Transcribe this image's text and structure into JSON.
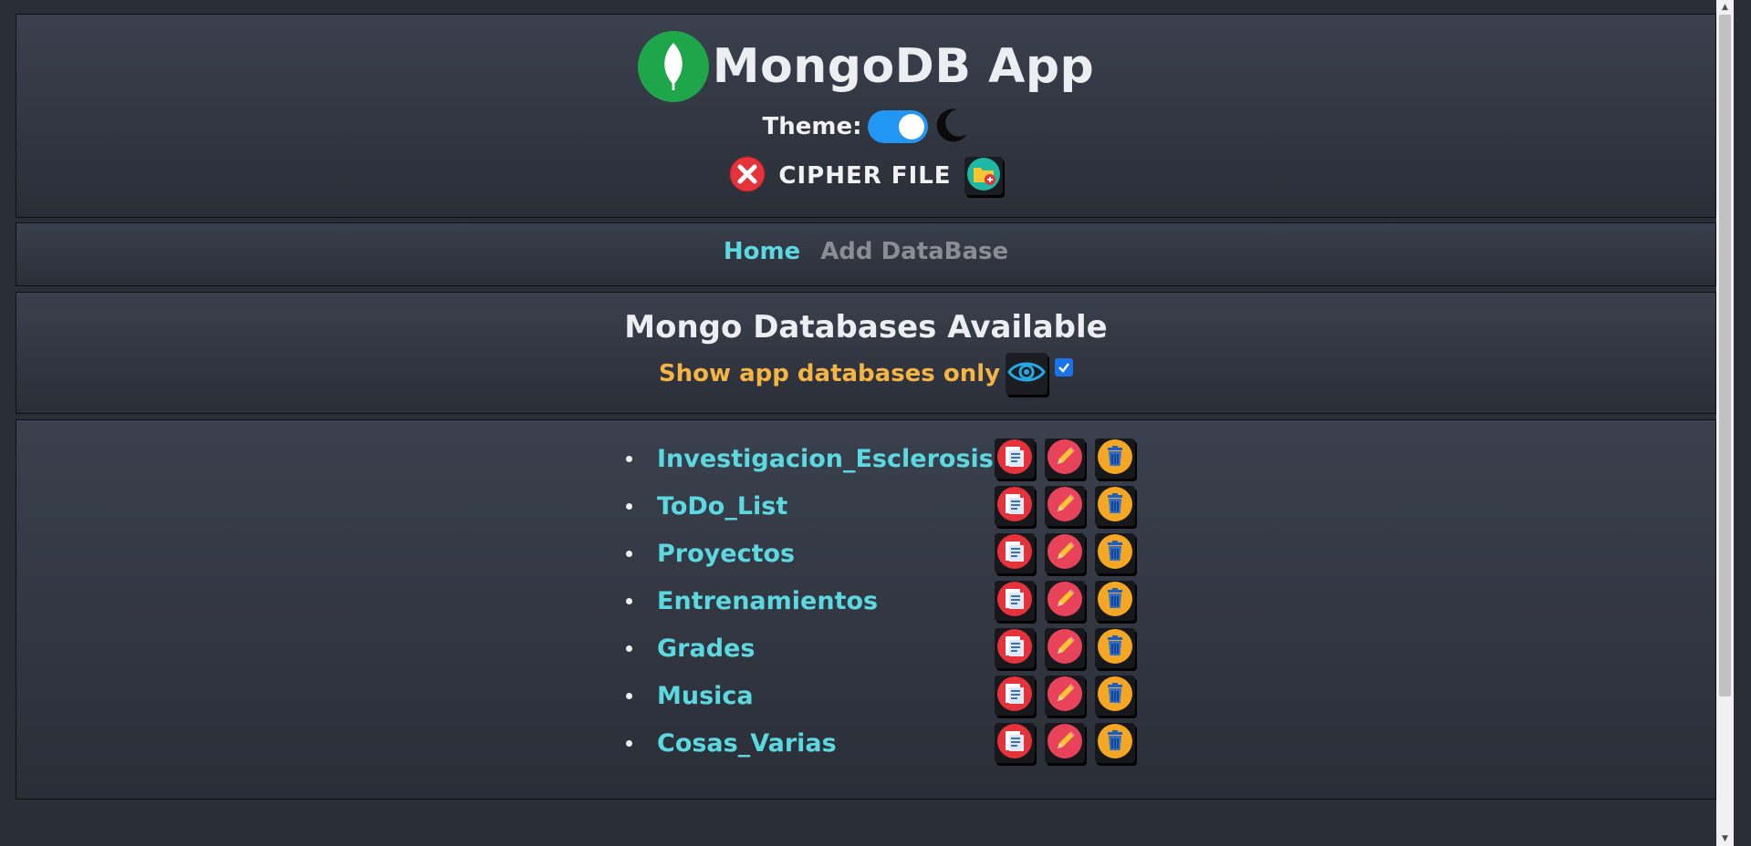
{
  "app": {
    "title": "MongoDB App",
    "theme_label": "Theme:",
    "cipher_label": "CIPHER FILE"
  },
  "nav": {
    "home": "Home",
    "add_database": "Add DataBase"
  },
  "section": {
    "title": "Mongo Databases Available",
    "filter_label": "Show app databases only",
    "filter_checked": true
  },
  "databases": [
    {
      "name": "Investigacion_Esclerosis"
    },
    {
      "name": "ToDo_List"
    },
    {
      "name": "Proyectos"
    },
    {
      "name": "Entrenamientos"
    },
    {
      "name": "Grades"
    },
    {
      "name": "Musica"
    },
    {
      "name": "Cosas_Varias"
    }
  ],
  "icons": {
    "logo": "leaf-icon",
    "theme_toggle": "toggle-switch",
    "dark_mode": "moon-icon",
    "cipher_status": "red-x-icon",
    "cipher_add": "folder-add-icon",
    "filter_view": "eye-icon",
    "row_open": "document-icon",
    "row_edit": "pencil-icon",
    "row_delete": "trash-icon"
  },
  "colors": {
    "accent_cyan": "#5cd9e0",
    "filter_orange": "#f5b545",
    "toggle_blue": "#2196f3",
    "logo_green": "#1fa64a"
  }
}
